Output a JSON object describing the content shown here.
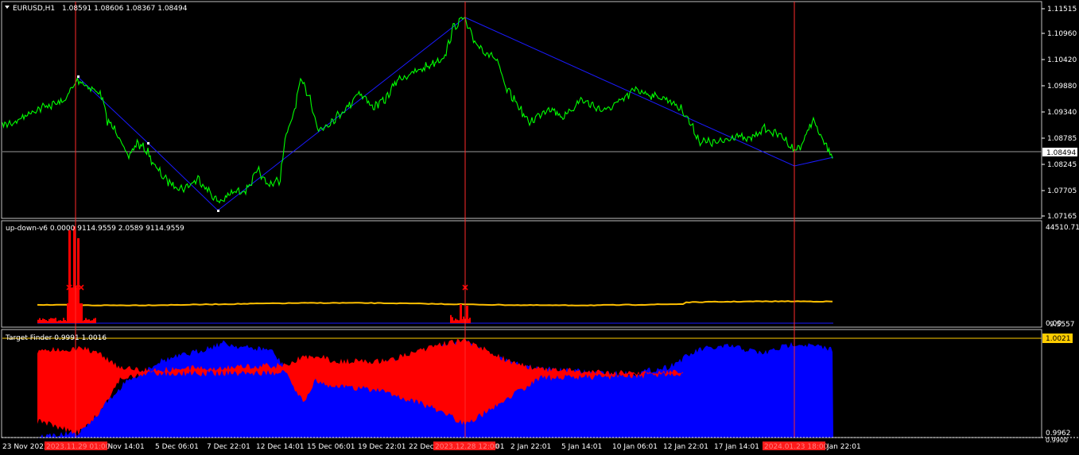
{
  "main_header": {
    "symbol": "EURUSD,H1",
    "ohlc": "1.08591 1.08606 1.08367 1.08494"
  },
  "indicator1": {
    "label": "up-down-v6 0.0000 9114.9559 2.0589 9114.9559",
    "axis_top": "44510.716",
    "axis_bottom": "9.5557",
    "axis_bottom_prefix": "0.00"
  },
  "indicator2": {
    "label": "Target Finder 0.9991 1.0016",
    "axis_top": "1.0021",
    "axis_bottom": "0.9962",
    "axis_bottom_cut": "0.9900"
  },
  "price_axis": {
    "ticks": [
      "1.11515",
      "1.10960",
      "1.10420",
      "1.09880",
      "1.09340",
      "1.08785",
      "1.08245",
      "1.07705",
      "1.07165"
    ],
    "current": "1.08494"
  },
  "time_axis": {
    "ticks": [
      "23 Nov 2023",
      "30 Nov 14:01",
      "5 Dec 06:01",
      "7 Dec 22:01",
      "12 Dec 14:01",
      "15 Dec 06:01",
      "19 Dec 22:01",
      "22 Dec",
      "01",
      "2 Jan 22:01",
      "5 Jan 14:01",
      "10 Jan 06:01",
      "12 Jan 22:01",
      "17 Jan 14:01",
      "Jan 22:01"
    ],
    "markers": [
      "2023.11.29 01:00",
      "2023.12.28 12:00",
      "2024.01.23 18:00"
    ]
  },
  "colors": {
    "price_line": "#00ff00",
    "zigzag": "#1a1aff",
    "vline": "#ff2a2a",
    "indicator_yellow": "#ffbf00",
    "indicator_red": "#ff0000",
    "indicator_blue": "#0000ff",
    "label_bg": "#ff1a1a",
    "current_bg": "#ffffff",
    "tf_bg": "#ffcc00"
  }
}
